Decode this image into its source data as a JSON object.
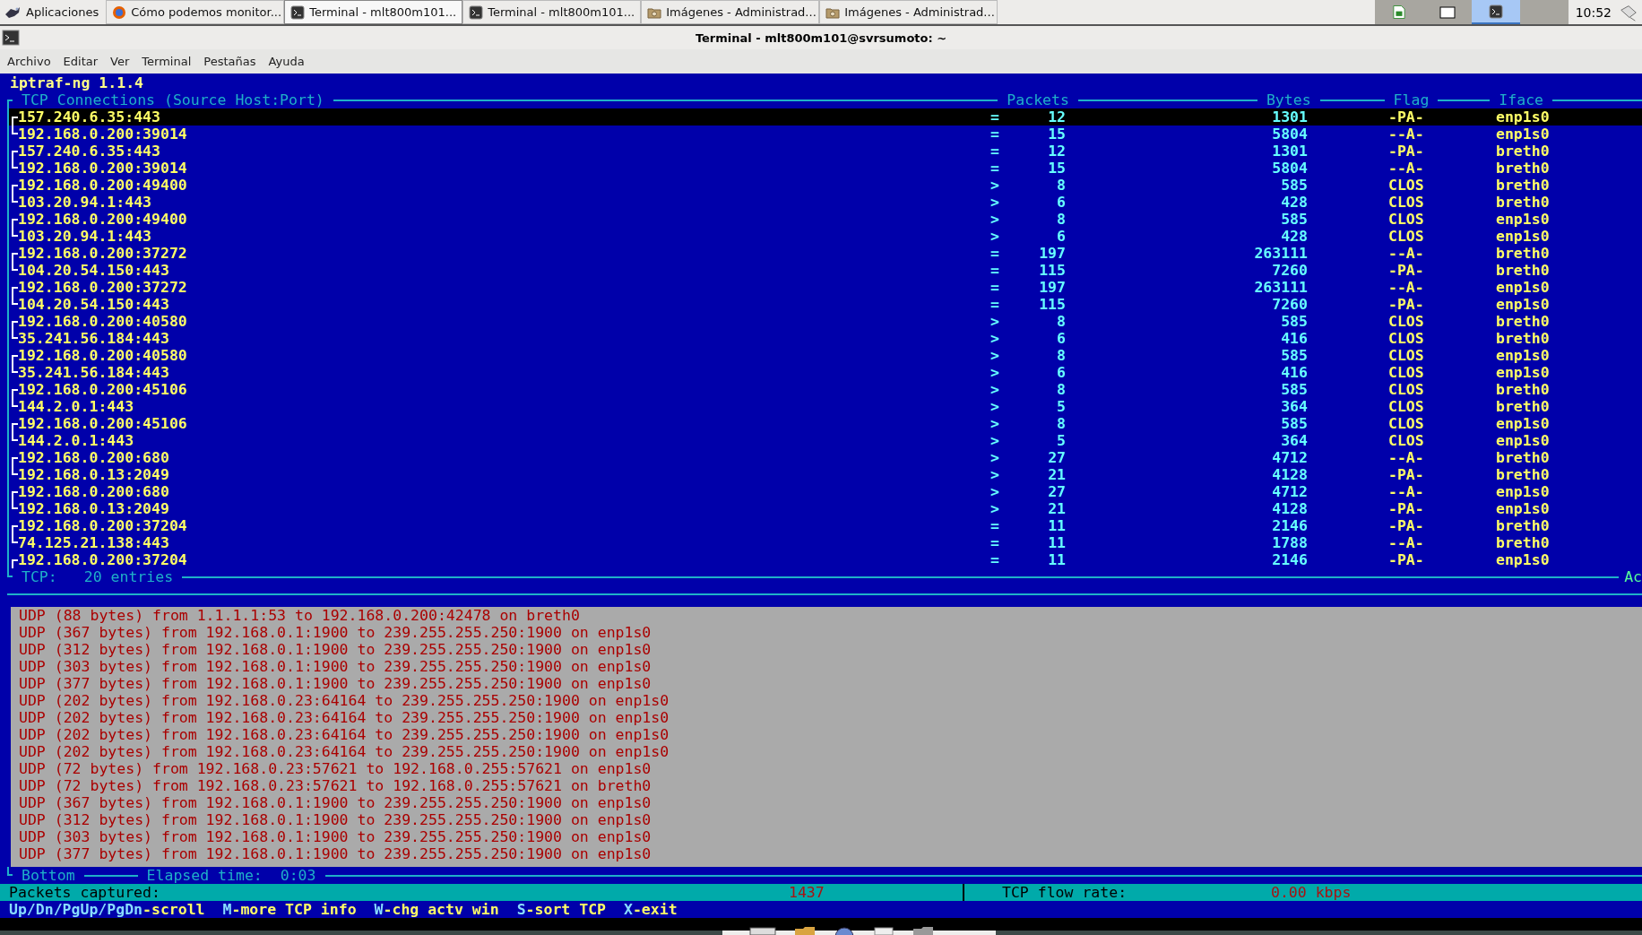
{
  "taskbar": {
    "menu_label": "Aplicaciones",
    "tasks": [
      {
        "label": "Cómo podemos monitor...",
        "kind": "browser",
        "selected": false
      },
      {
        "label": "Terminal - mlt800m101...",
        "kind": "terminal",
        "selected": true
      },
      {
        "label": "Terminal - mlt800m101...",
        "kind": "terminal",
        "selected": false
      },
      {
        "label": "Imágenes - Administrad...",
        "kind": "folder",
        "selected": false
      },
      {
        "label": "Imágenes - Administrad...",
        "kind": "folder",
        "selected": false
      }
    ],
    "workspaces": [
      {
        "kind": "spreadsheet",
        "selected": false
      },
      {
        "kind": "window",
        "selected": false
      },
      {
        "kind": "terminal",
        "selected": true
      },
      {
        "kind": "empty",
        "selected": false
      }
    ],
    "clock": "10:52"
  },
  "window": {
    "title": "Terminal - mlt800m101@svrsumoto: ~"
  },
  "menu": [
    "Archivo",
    "Editar",
    "Ver",
    "Terminal",
    "Pestañas",
    "Ayuda"
  ],
  "terminal": {
    "app_title": "iptraf-ng 1.1.4",
    "tcp_panel": {
      "title": "TCP Connections (Source Host:Port)",
      "columns": [
        "Packets",
        "Bytes",
        "Flag",
        "Iface"
      ],
      "rows": [
        {
          "host": "157.240.6.35:443",
          "column_2": "=",
          "packets": "12",
          "bytes": "1301",
          "flag": "-PA-",
          "iface": "enp1s0",
          "selected": true
        },
        {
          "host": "192.168.0.200:39014",
          "column_2": "=",
          "packets": "15",
          "bytes": "5804",
          "flag": "--A-",
          "iface": "enp1s0",
          "selected": false
        },
        {
          "host": "157.240.6.35:443",
          "column_2": "=",
          "packets": "12",
          "bytes": "1301",
          "flag": "-PA-",
          "iface": "breth0",
          "selected": false
        },
        {
          "host": "192.168.0.200:39014",
          "column_2": "=",
          "packets": "15",
          "bytes": "5804",
          "flag": "--A-",
          "iface": "breth0",
          "selected": false
        },
        {
          "host": "192.168.0.200:49400",
          "column_2": ">",
          "packets": "8",
          "bytes": "585",
          "flag": "CLOS",
          "iface": "breth0",
          "selected": false
        },
        {
          "host": "103.20.94.1:443",
          "column_2": ">",
          "packets": "6",
          "bytes": "428",
          "flag": "CLOS",
          "iface": "breth0",
          "selected": false
        },
        {
          "host": "192.168.0.200:49400",
          "column_2": ">",
          "packets": "8",
          "bytes": "585",
          "flag": "CLOS",
          "iface": "enp1s0",
          "selected": false
        },
        {
          "host": "103.20.94.1:443",
          "column_2": ">",
          "packets": "6",
          "bytes": "428",
          "flag": "CLOS",
          "iface": "enp1s0",
          "selected": false
        },
        {
          "host": "192.168.0.200:37272",
          "column_2": "=",
          "packets": "197",
          "bytes": "263111",
          "flag": "--A-",
          "iface": "breth0",
          "selected": false
        },
        {
          "host": "104.20.54.150:443",
          "column_2": "=",
          "packets": "115",
          "bytes": "7260",
          "flag": "-PA-",
          "iface": "breth0",
          "selected": false
        },
        {
          "host": "192.168.0.200:37272",
          "column_2": "=",
          "packets": "197",
          "bytes": "263111",
          "flag": "--A-",
          "iface": "enp1s0",
          "selected": false
        },
        {
          "host": "104.20.54.150:443",
          "column_2": "=",
          "packets": "115",
          "bytes": "7260",
          "flag": "-PA-",
          "iface": "enp1s0",
          "selected": false
        },
        {
          "host": "192.168.0.200:40580",
          "column_2": ">",
          "packets": "8",
          "bytes": "585",
          "flag": "CLOS",
          "iface": "breth0",
          "selected": false
        },
        {
          "host": "35.241.56.184:443",
          "column_2": ">",
          "packets": "6",
          "bytes": "416",
          "flag": "CLOS",
          "iface": "breth0",
          "selected": false
        },
        {
          "host": "192.168.0.200:40580",
          "column_2": ">",
          "packets": "8",
          "bytes": "585",
          "flag": "CLOS",
          "iface": "enp1s0",
          "selected": false
        },
        {
          "host": "35.241.56.184:443",
          "column_2": ">",
          "packets": "6",
          "bytes": "416",
          "flag": "CLOS",
          "iface": "enp1s0",
          "selected": false
        },
        {
          "host": "192.168.0.200:45106",
          "column_2": ">",
          "packets": "8",
          "bytes": "585",
          "flag": "CLOS",
          "iface": "breth0",
          "selected": false
        },
        {
          "host": "144.2.0.1:443",
          "column_2": ">",
          "packets": "5",
          "bytes": "364",
          "flag": "CLOS",
          "iface": "breth0",
          "selected": false
        },
        {
          "host": "192.168.0.200:45106",
          "column_2": ">",
          "packets": "8",
          "bytes": "585",
          "flag": "CLOS",
          "iface": "enp1s0",
          "selected": false
        },
        {
          "host": "144.2.0.1:443",
          "column_2": ">",
          "packets": "5",
          "bytes": "364",
          "flag": "CLOS",
          "iface": "enp1s0",
          "selected": false
        },
        {
          "host": "192.168.0.200:680",
          "column_2": ">",
          "packets": "27",
          "bytes": "4712",
          "flag": "--A-",
          "iface": "breth0",
          "selected": false
        },
        {
          "host": "192.168.0.13:2049",
          "column_2": ">",
          "packets": "21",
          "bytes": "4128",
          "flag": "-PA-",
          "iface": "breth0",
          "selected": false
        },
        {
          "host": "192.168.0.200:680",
          "column_2": ">",
          "packets": "27",
          "bytes": "4712",
          "flag": "--A-",
          "iface": "enp1s0",
          "selected": false
        },
        {
          "host": "192.168.0.13:2049",
          "column_2": ">",
          "packets": "21",
          "bytes": "4128",
          "flag": "-PA-",
          "iface": "enp1s0",
          "selected": false
        },
        {
          "host": "192.168.0.200:37204",
          "column_2": "=",
          "packets": "11",
          "bytes": "2146",
          "flag": "-PA-",
          "iface": "breth0",
          "selected": false
        },
        {
          "host": "74.125.21.138:443",
          "column_2": "=",
          "packets": "11",
          "bytes": "1788",
          "flag": "--A-",
          "iface": "breth0",
          "selected": false
        },
        {
          "host": "192.168.0.200:37204",
          "column_2": "=",
          "packets": "11",
          "bytes": "2146",
          "flag": "-PA-",
          "iface": "enp1s0",
          "selected": false
        }
      ],
      "footer_label": "TCP:",
      "footer_count": "20 entries",
      "footer_right": "Ac"
    },
    "udp_lines": [
      "UDP (88 bytes) from 1.1.1.1:53 to 192.168.0.200:42478 on breth0",
      "UDP (367 bytes) from 192.168.0.1:1900 to 239.255.255.250:1900 on enp1s0",
      "UDP (312 bytes) from 192.168.0.1:1900 to 239.255.255.250:1900 on enp1s0",
      "UDP (303 bytes) from 192.168.0.1:1900 to 239.255.255.250:1900 on enp1s0",
      "UDP (377 bytes) from 192.168.0.1:1900 to 239.255.255.250:1900 on enp1s0",
      "UDP (202 bytes) from 192.168.0.23:64164 to 239.255.255.250:1900 on enp1s0",
      "UDP (202 bytes) from 192.168.0.23:64164 to 239.255.255.250:1900 on enp1s0",
      "UDP (202 bytes) from 192.168.0.23:64164 to 239.255.255.250:1900 on enp1s0",
      "UDP (202 bytes) from 192.168.0.23:64164 to 239.255.255.250:1900 on enp1s0",
      "UDP (72 bytes) from 192.168.0.23:57621 to 192.168.0.255:57621 on enp1s0",
      "UDP (72 bytes) from 192.168.0.23:57621 to 192.168.0.255:57621 on breth0",
      "UDP (367 bytes) from 192.168.0.1:1900 to 239.255.255.250:1900 on enp1s0",
      "UDP (312 bytes) from 192.168.0.1:1900 to 239.255.255.250:1900 on enp1s0",
      "UDP (303 bytes) from 192.168.0.1:1900 to 239.255.255.250:1900 on enp1s0",
      "UDP (377 bytes) from 192.168.0.1:1900 to 239.255.255.250:1900 on enp1s0"
    ],
    "bottom_label": "Bottom",
    "elapsed_label": "Elapsed time:",
    "elapsed": "0:03",
    "status": {
      "packets_label": "Packets captured:",
      "packets": "1437",
      "flow_label": "TCP flow rate:",
      "flow": "0.00 kbps"
    },
    "keys": [
      {
        "key": "Up/Dn/PgUp/PgDn",
        "label": "-scroll"
      },
      {
        "key": "M",
        "label": "-more TCP info"
      },
      {
        "key": "W",
        "label": "-chg actv win"
      },
      {
        "key": "S",
        "label": "-sort TCP"
      },
      {
        "key": "X",
        "label": "-exit"
      }
    ]
  }
}
